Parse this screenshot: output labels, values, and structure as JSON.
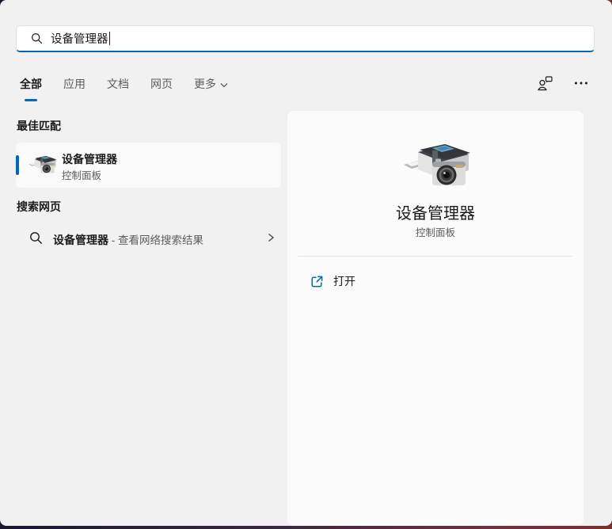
{
  "search": {
    "value": "设备管理器",
    "icon": "search-icon"
  },
  "tabs": [
    {
      "label": "全部",
      "active": true
    },
    {
      "label": "应用",
      "active": false
    },
    {
      "label": "文档",
      "active": false
    },
    {
      "label": "网页",
      "active": false
    },
    {
      "label": "更多",
      "active": false,
      "has_dropdown": true
    }
  ],
  "top_actions": {
    "account_icon": "account-feedback-icon",
    "more_icon": "more-options-icon"
  },
  "sections": {
    "best_match": {
      "header": "最佳匹配",
      "item": {
        "title": "设备管理器",
        "subtitle": "控制面板",
        "icon": "device-manager-icon"
      }
    },
    "web_search": {
      "header": "搜索网页",
      "item": {
        "query": "设备管理器",
        "suffix": " - 查看网络搜索结果",
        "icon": "search-icon",
        "chevron": "chevron-right-icon"
      }
    }
  },
  "preview": {
    "icon": "device-manager-icon",
    "title": "设备管理器",
    "subtitle": "控制面板",
    "actions": [
      {
        "label": "打开",
        "icon": "open-external-icon"
      }
    ]
  },
  "colors": {
    "accent": "#0067c0",
    "window_bg": "#f1f1f1",
    "card_bg": "#fafafa",
    "preview_bg": "#fbfbfb",
    "text_primary": "#1b1b1b",
    "text_secondary": "#5d5d5d",
    "searchbox_bg": "#ffffff"
  }
}
